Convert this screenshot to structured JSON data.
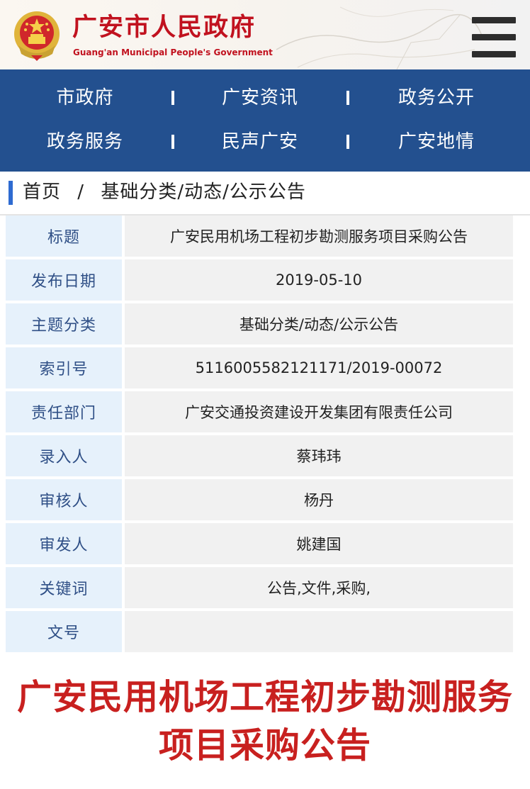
{
  "header": {
    "title": "广安市人民政府",
    "subtitle": "Guang'an Municipal People's Government",
    "menu_icon": "hamburger-menu-icon",
    "emblem_icon": "national-emblem-icon"
  },
  "nav": {
    "items": [
      "市政府",
      "广安资讯",
      "政务公开",
      "政务服务",
      "民声广安",
      "广安地情"
    ]
  },
  "breadcrumb": {
    "home": "首页",
    "separator": "/",
    "path": "基础分类/动态/公示公告"
  },
  "info": {
    "rows": [
      {
        "label": "标题",
        "value": "广安民用机场工程初步勘测服务项目采购公告"
      },
      {
        "label": "发布日期",
        "value": "2019-05-10"
      },
      {
        "label": "主题分类",
        "value": "基础分类/动态/公示公告"
      },
      {
        "label": "索引号",
        "value": "5116005582121171/2019-00072"
      },
      {
        "label": "责任部门",
        "value": "广安交通投资建设开发集团有限责任公司"
      },
      {
        "label": "录入人",
        "value": "蔡玮玮"
      },
      {
        "label": "审核人",
        "value": "杨丹"
      },
      {
        "label": "审发人",
        "value": "姚建国"
      },
      {
        "label": "关键词",
        "value": "公告,文件,采购,"
      },
      {
        "label": "文号",
        "value": ""
      }
    ]
  },
  "article": {
    "title": "广安民用机场工程初步勘测服务项目采购公告"
  },
  "colors": {
    "brand_red": "#c1121f",
    "nav_blue": "#23508f",
    "accent_blue": "#2e6bd1",
    "label_bg": "#e6f1fb",
    "value_bg": "#f1f1f1"
  }
}
